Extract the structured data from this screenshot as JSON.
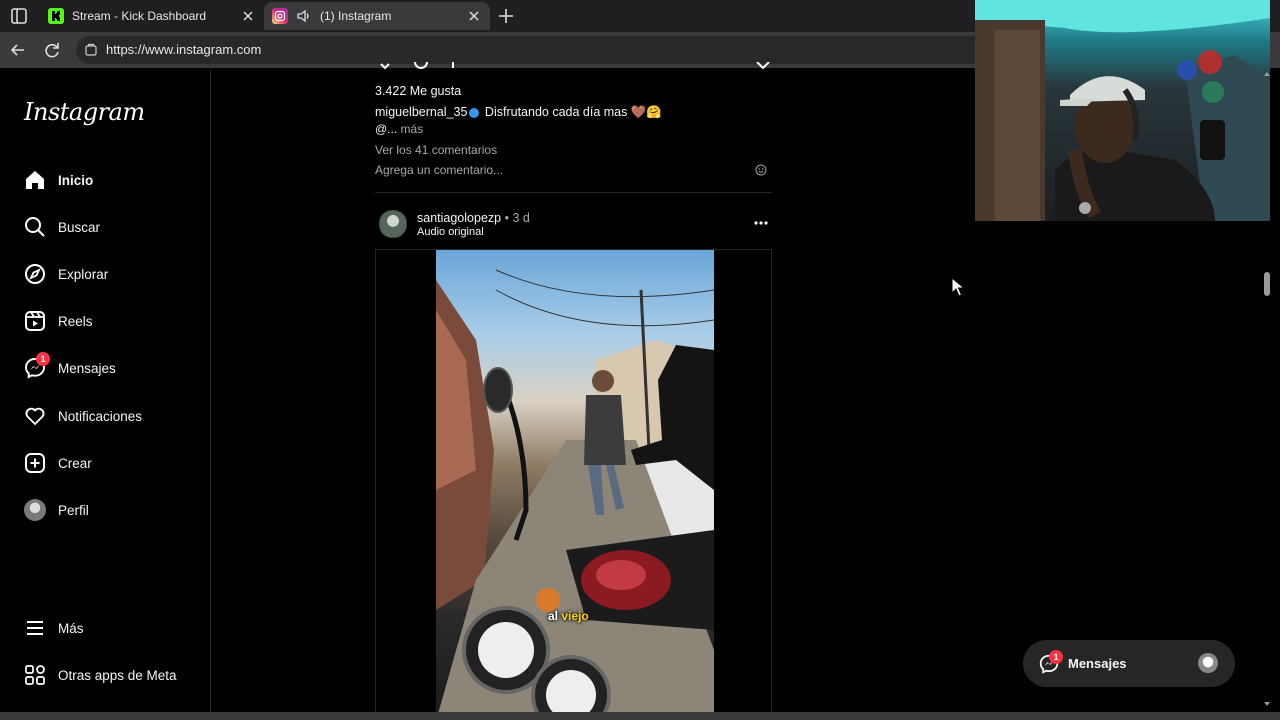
{
  "browser": {
    "tabs": [
      {
        "title": "Stream - Kick Dashboard",
        "favicon": "kick-favicon",
        "color": "#53fc18"
      },
      {
        "title": "(1) Instagram",
        "favicon": "instagram-favicon",
        "color": "#e1306c"
      }
    ],
    "url": "https://www.instagram.com"
  },
  "sidebar": {
    "logo": "Instagram",
    "items": [
      {
        "label": "Inicio",
        "icon": "home-icon"
      },
      {
        "label": "Buscar",
        "icon": "search-icon"
      },
      {
        "label": "Explorar",
        "icon": "compass-icon"
      },
      {
        "label": "Reels",
        "icon": "reels-icon"
      },
      {
        "label": "Mensajes",
        "icon": "messenger-icon",
        "badge": "1"
      },
      {
        "label": "Notificaciones",
        "icon": "heart-icon"
      },
      {
        "label": "Crear",
        "icon": "plus-square-icon"
      },
      {
        "label": "Perfil",
        "icon": "avatar"
      }
    ],
    "bottom": [
      {
        "label": "Más",
        "icon": "menu-icon"
      },
      {
        "label": "Otras apps de Meta",
        "icon": "apps-icon"
      }
    ]
  },
  "previous_post": {
    "likes": "3.422 Me gusta",
    "caption_user": "miguelbernal_35",
    "caption_text": "Disfrutando cada día mas 🤎🤗",
    "caption_more_prefix": "@...",
    "caption_more": "más",
    "comments_link": "Ver los 41 comentarios",
    "add_comment_placeholder": "Agrega un comentario..."
  },
  "post": {
    "username": "santiagolopezp",
    "time": "3 d",
    "audio": "Audio original",
    "video_subtitle_a": "al",
    "video_subtitle_b": "viejo"
  },
  "messages_pill": {
    "label": "Mensajes",
    "badge": "1"
  },
  "colors": {
    "accent_badge": "#ff3040",
    "verified": "#3797f0",
    "background": "#000000"
  }
}
